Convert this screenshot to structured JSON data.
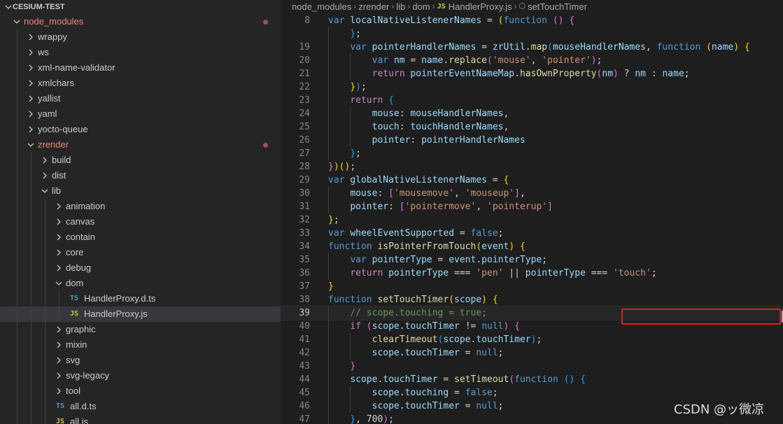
{
  "explorer": {
    "root_title": "CESIUM-TEST",
    "items": [
      {
        "label": "node_modules",
        "depth": 0,
        "type": "folder-open",
        "modified": true
      },
      {
        "label": "wrappy",
        "depth": 1,
        "type": "folder"
      },
      {
        "label": "ws",
        "depth": 1,
        "type": "folder"
      },
      {
        "label": "xml-name-validator",
        "depth": 1,
        "type": "folder"
      },
      {
        "label": "xmlchars",
        "depth": 1,
        "type": "folder"
      },
      {
        "label": "yallist",
        "depth": 1,
        "type": "folder"
      },
      {
        "label": "yaml",
        "depth": 1,
        "type": "folder"
      },
      {
        "label": "yocto-queue",
        "depth": 1,
        "type": "folder"
      },
      {
        "label": "zrender",
        "depth": 1,
        "type": "folder-open",
        "modified": true
      },
      {
        "label": "build",
        "depth": 2,
        "type": "folder"
      },
      {
        "label": "dist",
        "depth": 2,
        "type": "folder"
      },
      {
        "label": "lib",
        "depth": 2,
        "type": "folder-open"
      },
      {
        "label": "animation",
        "depth": 3,
        "type": "folder"
      },
      {
        "label": "canvas",
        "depth": 3,
        "type": "folder"
      },
      {
        "label": "contain",
        "depth": 3,
        "type": "folder"
      },
      {
        "label": "core",
        "depth": 3,
        "type": "folder"
      },
      {
        "label": "debug",
        "depth": 3,
        "type": "folder"
      },
      {
        "label": "dom",
        "depth": 3,
        "type": "folder-open"
      },
      {
        "label": "HandlerProxy.d.ts",
        "depth": 4,
        "type": "file",
        "ext": "TS"
      },
      {
        "label": "HandlerProxy.js",
        "depth": 4,
        "type": "file",
        "ext": "JS",
        "selected": true
      },
      {
        "label": "graphic",
        "depth": 3,
        "type": "folder"
      },
      {
        "label": "mixin",
        "depth": 3,
        "type": "folder"
      },
      {
        "label": "svg",
        "depth": 3,
        "type": "folder"
      },
      {
        "label": "svg-legacy",
        "depth": 3,
        "type": "folder"
      },
      {
        "label": "tool",
        "depth": 3,
        "type": "folder"
      },
      {
        "label": "all.d.ts",
        "depth": 3,
        "type": "file",
        "ext": "TS"
      },
      {
        "label": "all.js",
        "depth": 3,
        "type": "file",
        "ext": "JS"
      }
    ]
  },
  "breadcrumb": {
    "parts": [
      "node_modules",
      "zrender",
      "lib",
      "dom"
    ],
    "file_ext": "JS",
    "file": "HandlerProxy.js",
    "symbol": "setTouchTimer"
  },
  "editor": {
    "current_line": "39",
    "lines": [
      {
        "n": "8",
        "t": [
          [
            "k",
            "var "
          ],
          [
            "v",
            "localNativeListenerNames"
          ],
          [
            "p",
            " = "
          ],
          [
            "b1",
            "("
          ],
          [
            "k",
            "function"
          ],
          [
            "p",
            " "
          ],
          [
            "b2",
            "()"
          ],
          [
            "p",
            " "
          ],
          [
            "b2",
            "{"
          ]
        ]
      },
      {
        "n": "",
        "t": [
          [
            "p",
            "    "
          ],
          [
            "b3",
            "}"
          ],
          [
            "p",
            ";"
          ]
        ]
      },
      {
        "n": "19",
        "t": [
          [
            "p",
            "    "
          ],
          [
            "k",
            "var "
          ],
          [
            "v",
            "pointerHandlerNames"
          ],
          [
            "p",
            " = "
          ],
          [
            "v",
            "zrUtil"
          ],
          [
            "p",
            "."
          ],
          [
            "f",
            "map"
          ],
          [
            "b3",
            "("
          ],
          [
            "v",
            "mouseHandlerNames"
          ],
          [
            "p",
            ", "
          ],
          [
            "k",
            "function"
          ],
          [
            "p",
            " "
          ],
          [
            "b1",
            "("
          ],
          [
            "v",
            "name"
          ],
          [
            "b1",
            ")"
          ],
          [
            "p",
            " "
          ],
          [
            "b1",
            "{"
          ]
        ]
      },
      {
        "n": "20",
        "t": [
          [
            "p",
            "        "
          ],
          [
            "k",
            "var "
          ],
          [
            "v",
            "nm"
          ],
          [
            "p",
            " = "
          ],
          [
            "v",
            "name"
          ],
          [
            "p",
            "."
          ],
          [
            "f",
            "replace"
          ],
          [
            "b2",
            "("
          ],
          [
            "s",
            "'mouse'"
          ],
          [
            "p",
            ", "
          ],
          [
            "s",
            "'pointer'"
          ],
          [
            "b2",
            ")"
          ],
          [
            "p",
            ";"
          ]
        ]
      },
      {
        "n": "21",
        "t": [
          [
            "p",
            "        "
          ],
          [
            "kc",
            "return "
          ],
          [
            "v",
            "pointerEventNameMap"
          ],
          [
            "p",
            "."
          ],
          [
            "f",
            "hasOwnProperty"
          ],
          [
            "b2",
            "("
          ],
          [
            "v",
            "nm"
          ],
          [
            "b2",
            ")"
          ],
          [
            "p",
            " ? "
          ],
          [
            "v",
            "nm"
          ],
          [
            "p",
            " : "
          ],
          [
            "v",
            "name"
          ],
          [
            "p",
            ";"
          ]
        ]
      },
      {
        "n": "22",
        "t": [
          [
            "p",
            "    "
          ],
          [
            "b1",
            "}"
          ],
          [
            "b3",
            ")"
          ],
          [
            "p",
            ";"
          ]
        ]
      },
      {
        "n": "23",
        "t": [
          [
            "p",
            "    "
          ],
          [
            "kc",
            "return "
          ],
          [
            "b3",
            "{"
          ]
        ]
      },
      {
        "n": "24",
        "t": [
          [
            "p",
            "        "
          ],
          [
            "v",
            "mouse"
          ],
          [
            "p",
            ": "
          ],
          [
            "v",
            "mouseHandlerNames"
          ],
          [
            "p",
            ","
          ]
        ]
      },
      {
        "n": "25",
        "t": [
          [
            "p",
            "        "
          ],
          [
            "v",
            "touch"
          ],
          [
            "p",
            ": "
          ],
          [
            "v",
            "touchHandlerNames"
          ],
          [
            "p",
            ","
          ]
        ]
      },
      {
        "n": "26",
        "t": [
          [
            "p",
            "        "
          ],
          [
            "v",
            "pointer"
          ],
          [
            "p",
            ": "
          ],
          [
            "v",
            "pointerHandlerNames"
          ]
        ]
      },
      {
        "n": "27",
        "t": [
          [
            "p",
            "    "
          ],
          [
            "b3",
            "}"
          ],
          [
            "p",
            ";"
          ]
        ]
      },
      {
        "n": "28",
        "t": [
          [
            "b2",
            "}"
          ],
          [
            "b1",
            ")"
          ],
          [
            "b1",
            "()"
          ],
          [
            "p",
            ";"
          ]
        ]
      },
      {
        "n": "29",
        "t": [
          [
            "k",
            "var "
          ],
          [
            "v",
            "globalNativeListenerNames"
          ],
          [
            "p",
            " = "
          ],
          [
            "b1",
            "{"
          ]
        ]
      },
      {
        "n": "30",
        "t": [
          [
            "p",
            "    "
          ],
          [
            "v",
            "mouse"
          ],
          [
            "p",
            ": "
          ],
          [
            "b2",
            "["
          ],
          [
            "s",
            "'mousemove'"
          ],
          [
            "p",
            ", "
          ],
          [
            "s",
            "'mouseup'"
          ],
          [
            "b2",
            "]"
          ],
          [
            "p",
            ","
          ]
        ]
      },
      {
        "n": "31",
        "t": [
          [
            "p",
            "    "
          ],
          [
            "v",
            "pointer"
          ],
          [
            "p",
            ": "
          ],
          [
            "b2",
            "["
          ],
          [
            "s",
            "'pointermove'"
          ],
          [
            "p",
            ", "
          ],
          [
            "s",
            "'pointerup'"
          ],
          [
            "b2",
            "]"
          ]
        ]
      },
      {
        "n": "32",
        "t": [
          [
            "b1",
            "}"
          ],
          [
            "p",
            ";"
          ]
        ]
      },
      {
        "n": "33",
        "t": [
          [
            "k",
            "var "
          ],
          [
            "v",
            "wheelEventSupported"
          ],
          [
            "p",
            " = "
          ],
          [
            "k",
            "false"
          ],
          [
            "p",
            ";"
          ]
        ]
      },
      {
        "n": "34",
        "t": [
          [
            "k",
            "function "
          ],
          [
            "f",
            "isPointerFromTouch"
          ],
          [
            "b1",
            "("
          ],
          [
            "v",
            "event"
          ],
          [
            "b1",
            ")"
          ],
          [
            "p",
            " "
          ],
          [
            "b1",
            "{"
          ]
        ]
      },
      {
        "n": "35",
        "t": [
          [
            "p",
            "    "
          ],
          [
            "k",
            "var "
          ],
          [
            "v",
            "pointerType"
          ],
          [
            "p",
            " = "
          ],
          [
            "v",
            "event"
          ],
          [
            "p",
            "."
          ],
          [
            "v",
            "pointerType"
          ],
          [
            "p",
            ";"
          ]
        ]
      },
      {
        "n": "36",
        "t": [
          [
            "p",
            "    "
          ],
          [
            "kc",
            "return "
          ],
          [
            "v",
            "pointerType"
          ],
          [
            "p",
            " === "
          ],
          [
            "s",
            "'pen'"
          ],
          [
            "p",
            " || "
          ],
          [
            "v",
            "pointerType"
          ],
          [
            "p",
            " === "
          ],
          [
            "s",
            "'touch'"
          ],
          [
            "p",
            ";"
          ]
        ]
      },
      {
        "n": "37",
        "t": [
          [
            "b1",
            "}"
          ]
        ]
      },
      {
        "n": "38",
        "t": [
          [
            "k",
            "function "
          ],
          [
            "f",
            "setTouchTimer"
          ],
          [
            "b1",
            "("
          ],
          [
            "v",
            "scope"
          ],
          [
            "b1",
            ")"
          ],
          [
            "p",
            " "
          ],
          [
            "b1",
            "{"
          ]
        ]
      },
      {
        "n": "39",
        "t": [
          [
            "p",
            "    "
          ],
          [
            "c",
            "// scope.touching = true;"
          ]
        ]
      },
      {
        "n": "40",
        "t": [
          [
            "p",
            "    "
          ],
          [
            "kc",
            "if "
          ],
          [
            "b2",
            "("
          ],
          [
            "v",
            "scope"
          ],
          [
            "p",
            "."
          ],
          [
            "v",
            "touchTimer"
          ],
          [
            "p",
            " != "
          ],
          [
            "k",
            "null"
          ],
          [
            "b2",
            ")"
          ],
          [
            "p",
            " "
          ],
          [
            "b2",
            "{"
          ]
        ]
      },
      {
        "n": "41",
        "t": [
          [
            "p",
            "        "
          ],
          [
            "f",
            "clearTimeout"
          ],
          [
            "b3",
            "("
          ],
          [
            "v",
            "scope"
          ],
          [
            "p",
            "."
          ],
          [
            "v",
            "touchTimer"
          ],
          [
            "b3",
            ")"
          ],
          [
            "p",
            ";"
          ]
        ]
      },
      {
        "n": "42",
        "t": [
          [
            "p",
            "        "
          ],
          [
            "v",
            "scope"
          ],
          [
            "p",
            "."
          ],
          [
            "v",
            "touchTimer"
          ],
          [
            "p",
            " = "
          ],
          [
            "k",
            "null"
          ],
          [
            "p",
            ";"
          ]
        ]
      },
      {
        "n": "43",
        "t": [
          [
            "p",
            "    "
          ],
          [
            "b2",
            "}"
          ]
        ]
      },
      {
        "n": "44",
        "t": [
          [
            "p",
            "    "
          ],
          [
            "v",
            "scope"
          ],
          [
            "p",
            "."
          ],
          [
            "v",
            "touchTimer"
          ],
          [
            "p",
            " = "
          ],
          [
            "f",
            "setTimeout"
          ],
          [
            "b2",
            "("
          ],
          [
            "k",
            "function"
          ],
          [
            "p",
            " "
          ],
          [
            "b3",
            "()"
          ],
          [
            "p",
            " "
          ],
          [
            "b3",
            "{"
          ]
        ]
      },
      {
        "n": "45",
        "t": [
          [
            "p",
            "        "
          ],
          [
            "v",
            "scope"
          ],
          [
            "p",
            "."
          ],
          [
            "v",
            "touching"
          ],
          [
            "p",
            " = "
          ],
          [
            "k",
            "false"
          ],
          [
            "p",
            ";"
          ]
        ]
      },
      {
        "n": "46",
        "t": [
          [
            "p",
            "        "
          ],
          [
            "v",
            "scope"
          ],
          [
            "p",
            "."
          ],
          [
            "v",
            "touchTimer"
          ],
          [
            "p",
            " = "
          ],
          [
            "k",
            "null"
          ],
          [
            "p",
            ";"
          ]
        ]
      },
      {
        "n": "47",
        "t": [
          [
            "p",
            "    "
          ],
          [
            "b3",
            "}"
          ],
          [
            "p",
            ", "
          ],
          [
            "p",
            "700"
          ],
          [
            "b2",
            ")"
          ],
          [
            "p",
            ";"
          ]
        ]
      }
    ]
  },
  "watermark": "CSDN @ッ微凉",
  "colors": {
    "sidebar_bg": "#252526",
    "editor_bg": "#1e1e1e",
    "modified_text": "#f48771",
    "highlight_box": "#e0201a"
  }
}
